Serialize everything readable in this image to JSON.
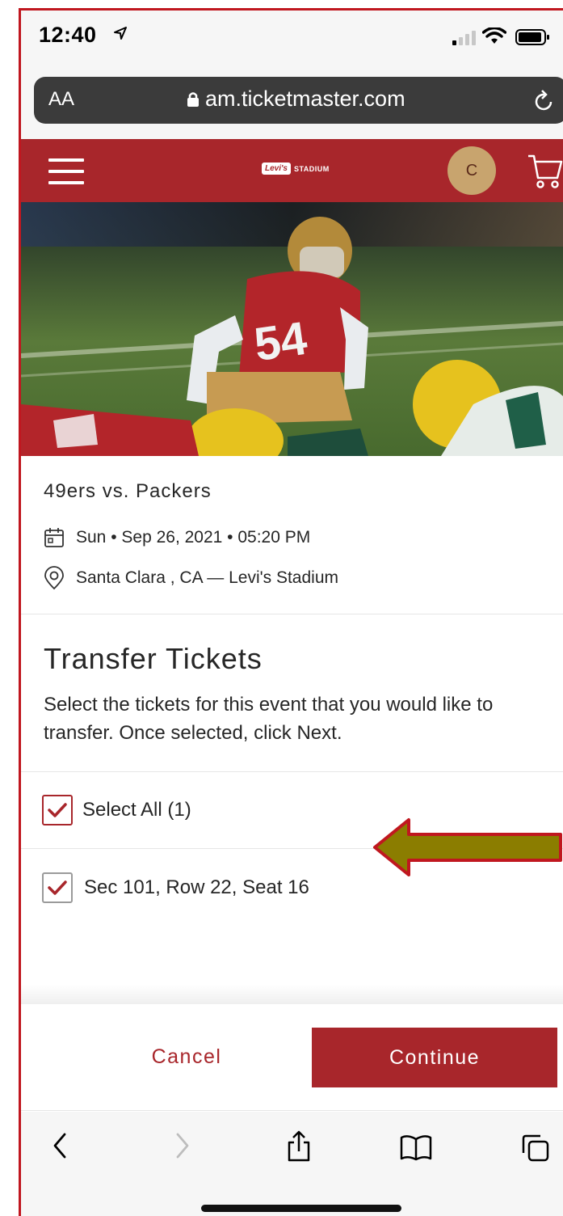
{
  "status_bar": {
    "time": "12:40"
  },
  "browser": {
    "text_size_label": "AA",
    "url": "am.ticketmaster.com"
  },
  "header": {
    "logo_badge": "Levi's",
    "logo_text": "STADIUM",
    "avatar_initial": "C"
  },
  "event": {
    "title": "49ers vs. Packers",
    "date": "Sun • Sep 26, 2021 • 05:20 PM",
    "venue": "Santa Clara , CA — Levi's Stadium"
  },
  "transfer": {
    "title": "Transfer Tickets",
    "description": "Select the tickets for this event that you would like to transfer. Once selected, click Next."
  },
  "tickets": {
    "select_all_label": "Select All (1)",
    "seat_label": "Sec 101, Row 22, Seat 16"
  },
  "footer": {
    "cancel_label": "Cancel",
    "continue_label": "Continue"
  },
  "colors": {
    "brand_red": "#a8262b",
    "avatar_gold": "#c8a46e",
    "annotation_arrow": "#8b7d00"
  },
  "icons": [
    "location-arrow-icon",
    "signal-icon",
    "wifi-icon",
    "battery-icon",
    "lock-icon",
    "reload-icon",
    "menu-icon",
    "cart-icon",
    "calendar-icon",
    "map-pin-icon",
    "checkmark-icon",
    "back-icon",
    "forward-icon",
    "share-icon",
    "bookmarks-icon",
    "tabs-icon"
  ]
}
